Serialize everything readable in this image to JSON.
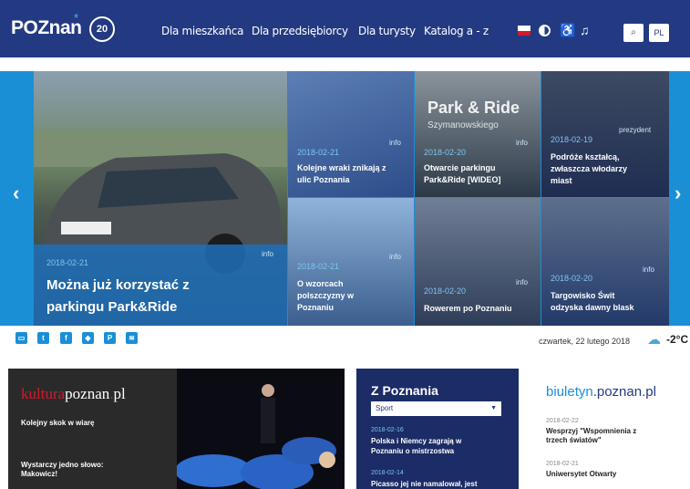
{
  "header": {
    "logo_text": "POZnan",
    "logo_star": "*",
    "badge": "20",
    "nav": [
      "Dla mieszkańca",
      "Dla przedsiębiorcy",
      "Dla turysty",
      "Katalog a - z"
    ],
    "search_label": "⌕",
    "lang_label": "PL",
    "access_glyph": "♿",
    "hearing_glyph": "♫"
  },
  "carousel": {
    "arrow_left": "‹",
    "arrow_right": "›",
    "main": {
      "date": "2018-02-21",
      "category": "info",
      "title_line1": "Można już korzystać z",
      "title_line2": "parkingu Park&Ride"
    },
    "tiles": [
      {
        "date": "2018-02-21",
        "category": "info",
        "title_line1": "Kolejne wraki znikają z",
        "title_line2": "ulic Poznania",
        "title_line3": "",
        "overlay": "",
        "overlay2": ""
      },
      {
        "date": "2018-02-20",
        "category": "info",
        "title_line1": "Otwarcie parkingu",
        "title_line2": "Park&Ride [WIDEO]",
        "title_line3": "",
        "overlay": "Park & Ride",
        "overlay2": "Szymanowskiego"
      },
      {
        "date": "2018-02-19",
        "category": "prezydent",
        "title_line1": "Podróże kształcą,",
        "title_line2": "zwłaszcza włodarzy",
        "title_line3": "miast",
        "overlay": "",
        "overlay2": ""
      },
      {
        "date": "2018-02-21",
        "category": "info",
        "title_line1": "O wzorcach",
        "title_line2": "polszczyzny w",
        "title_line3": "Poznaniu",
        "overlay": "",
        "overlay2": ""
      },
      {
        "date": "2018-02-20",
        "category": "info",
        "title_line1": "Rowerem po Poznaniu",
        "title_line2": "",
        "title_line3": "",
        "overlay": "",
        "overlay2": ""
      },
      {
        "date": "2018-02-20",
        "category": "info",
        "title_line1": "Targowisko Świt",
        "title_line2": "odzyska dawny blask",
        "title_line3": "",
        "overlay": "",
        "overlay2": ""
      }
    ]
  },
  "social": [
    "▭",
    "t",
    "f",
    "◆",
    "P",
    "≋"
  ],
  "date_text": "czwartek, 22 lutego 2018",
  "temperature": "-2°C",
  "kultura": {
    "logo_red": "kultura",
    "logo_white": "poznan",
    "logo_dot": ".",
    "logo_pl": "pl",
    "item1": "Kolejny skok w wiarę",
    "item2": "Wystarczy jedno słowo:",
    "item3": "Makowicz!"
  },
  "zpoznania": {
    "title": "Z Poznania",
    "select": "Sport",
    "news": [
      {
        "date": "2018-02-16",
        "line1": "Polska i Niemcy zagrają w",
        "line2": "Poznaniu o mistrzostwa"
      },
      {
        "date": "2018-02-14",
        "line1": "Picasso jej nie namalował, jest",
        "line2": ""
      }
    ]
  },
  "biuletyn": {
    "logo_a": "biuletyn",
    "logo_b": ".poznan.pl",
    "news": [
      {
        "date": "2018-02-22",
        "line1": "Wesprzyj \"Wspomnienia z",
        "line2": "trzech światów\""
      },
      {
        "date": "2018-02-21",
        "line1": "Uniwersytet Otwarty",
        "line2": ""
      }
    ]
  },
  "colors": {
    "header": "#233a82",
    "accent": "#1a8fd6",
    "date": "#7fc3f0"
  }
}
